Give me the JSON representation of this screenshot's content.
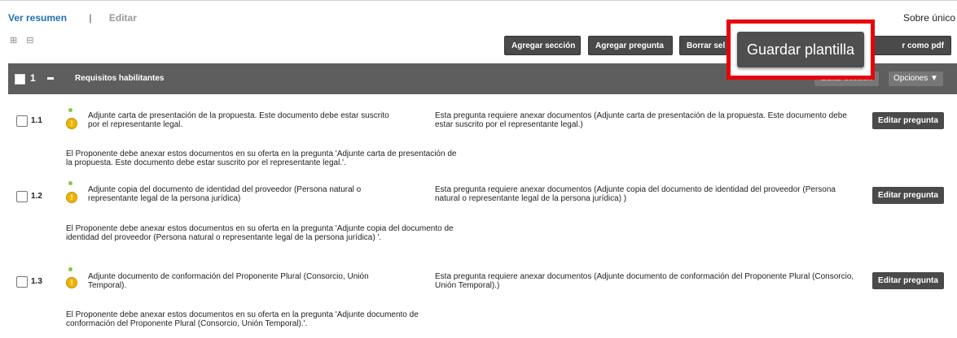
{
  "nav": {
    "ver_resumen": "Ver resumen",
    "separator": "|",
    "editar": "Editar",
    "sobre": "Sobre único"
  },
  "expand_icons": {
    "expand": "⊞",
    "collapse": "⊟"
  },
  "toolbar": {
    "agregar_seccion": "Agregar sección",
    "agregar_pregunta": "Agregar pregunta",
    "borrar_sel": "Borrar sel",
    "guardar_plantilla": "Guardar plantilla",
    "exportar_pdf": "r como pdf"
  },
  "section": {
    "number": "1",
    "title": "Requisitos habilitantes",
    "editar_seccion": "Editar sección",
    "opciones": "Opciones"
  },
  "questions": [
    {
      "number": "1.1",
      "text": "Adjunte carta de presentación de la propuesta. Este documento debe estar suscrito por el representante legal.",
      "description": "Esta pregunta requiere anexar documentos (Adjunte carta de presentación de la propuesta. Este documento debe estar suscrito por el representante legal.)",
      "note": "El Proponente debe anexar estos documentos en su oferta en la pregunta 'Adjunte carta de presentación de la propuesta. Este documento debe estar suscrito por el representante legal.'.",
      "edit_label": "Editar pregunta"
    },
    {
      "number": "1.2",
      "text": "Adjunte copia del documento de identidad del proveedor (Persona natural o representante legal de la persona jurídica)",
      "description": "Esta pregunta requiere anexar documentos (Adjunte copia del documento de identidad del proveedor (Persona natural o representante legal de la persona jurídica) )",
      "note": "El Proponente debe anexar estos documentos en su oferta en la pregunta 'Adjunte copia del documento de identidad del proveedor (Persona natural o representante legal de la persona jurídica) '.",
      "edit_label": "Editar pregunta"
    },
    {
      "number": "1.3",
      "text": "Adjunte documento de conformación del Proponente Plural (Consorcio, Unión Temporal).",
      "description": "Esta pregunta requiere anexar documentos (Adjunte documento de conformación del Proponente Plural (Consorcio, Unión Temporal).)",
      "note": "El Proponente debe anexar estos documentos en su oferta en la pregunta 'Adjunte documento de conformación del Proponente Plural (Consorcio, Unión Temporal).'.",
      "edit_label": "Editar pregunta"
    }
  ],
  "colors": {
    "highlight_border": "#e8000b",
    "button_bg": "#4a4a4a",
    "link": "#1f6fb5",
    "section_bar": "#5e5e5e"
  }
}
